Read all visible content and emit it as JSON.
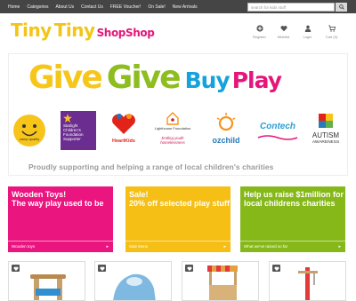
{
  "nav": {
    "links": [
      "Home",
      "Categories",
      "About Us",
      "Contact Us",
      "FREE Voucher!",
      "On Sale!",
      "New Arrivals"
    ],
    "search_placeholder": "search for kids stuff"
  },
  "logo": {
    "word1": "Tiny",
    "word2": "Tiny",
    "word3": "ShopShop"
  },
  "user_menu": [
    {
      "label": "Register",
      "icon": "plus-circle-icon"
    },
    {
      "label": "Wishlist",
      "icon": "heart-icon"
    },
    {
      "label": "Login",
      "icon": "user-icon"
    },
    {
      "label": "Cart (0)",
      "icon": "cart-icon"
    }
  ],
  "banner": {
    "word1": "Give",
    "word2": "Give",
    "word3": "Buy",
    "word4": "Play",
    "tagline": "Proudly supporting and helping a range of local children's charities",
    "charities": {
      "camp_quality": "camp quality",
      "starlight": "Starlight Children's Foundation Supporter",
      "heartkids": "HeartKids",
      "lighthouse": "Lighthouse Foundation",
      "lighthouse_sub": "Ending youth homelessness",
      "ozchild": "ozchild",
      "contech": "Contech",
      "autism1": "AUTISM",
      "autism2": "AWARENESS"
    }
  },
  "tiles": [
    {
      "heading": "Wooden Toys!\nThe way play used to be",
      "footer": "Wooden toys",
      "color": "#ea157f"
    },
    {
      "heading": "Sale!\n20% off selected play stuff",
      "footer": "Sale items",
      "color": "#f5bf15"
    },
    {
      "heading": "Help us raise $1million for local childrens charities",
      "footer": "What we've raised so far",
      "color": "#86b81a"
    }
  ],
  "colors": {
    "pink": "#e5157a",
    "yellow": "#f4c518",
    "green": "#8dbd1f",
    "blue": "#16a2dc",
    "nav": "#454545"
  }
}
